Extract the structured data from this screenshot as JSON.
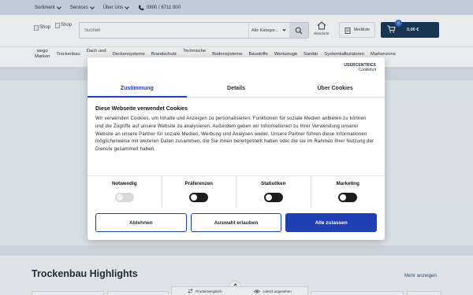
{
  "topbar": {
    "items": [
      {
        "label": "Sortiment"
      },
      {
        "label": "Services"
      },
      {
        "label": "Über Uns"
      }
    ],
    "phone": "0800 / 6711 000"
  },
  "header": {
    "logo_alt_1": "Shop",
    "logo_alt_2": "Shop",
    "search_placeholder": "Suchen",
    "category_select": "Alle Kategor...",
    "stores_label": "Standorte",
    "wishlist_label": "Merkliste",
    "cart_count": "0",
    "cart_total": "0,00 €"
  },
  "nav": {
    "items": [
      {
        "line1": "wego",
        "line2": "Marken"
      },
      {
        "line1": "Trockenbau",
        "line2": ""
      },
      {
        "line1": "Dach und",
        "line2": ""
      },
      {
        "line1": "Deckensysteme",
        "line2": ""
      },
      {
        "line1": "Brandschutz",
        "line2": ""
      },
      {
        "line1": "Technische",
        "line2": ""
      },
      {
        "line1": "Bodensysteme",
        "line2": ""
      },
      {
        "line1": "Baustoffe",
        "line2": ""
      },
      {
        "line1": "Werkzeuge",
        "line2": ""
      },
      {
        "line1": "Sanitär",
        "line2": ""
      },
      {
        "line1": "Systemkalkulatoren",
        "line2": ""
      },
      {
        "line1": "Markenzone",
        "line2": ""
      }
    ]
  },
  "cookie": {
    "brand_name": "USERCENTRICS",
    "brand_sub": "Cookiebot",
    "tabs": [
      {
        "label": "Zustimmung"
      },
      {
        "label": "Details"
      },
      {
        "label": "Über Cookies"
      }
    ],
    "heading": "Diese Webseite verwendet Cookies",
    "body": "Wir verwenden Cookies, um Inhalte und Anzeigen zu personalisieren, Funktionen für soziale Medien anbieten zu können und die Zugriffe auf unsere Website zu analysieren. Außerdem geben wir Informationen zu Ihrer Verwendung unserer Website an unsere Partner für soziale Medien, Werbung und Analysen weiter. Unsere Partner führen diese Informationen möglicherweise mit weiteren Daten zusammen, die Sie ihnen bereitgestellt haben oder die sie im Rahmen Ihrer Nutzung der Dienste gesammelt haben.",
    "categories": [
      {
        "label": "Notwendig",
        "state": "disabled-on"
      },
      {
        "label": "Präferenzen",
        "state": "off"
      },
      {
        "label": "Statistiken",
        "state": "off"
      },
      {
        "label": "Marketing",
        "state": "off"
      }
    ],
    "buttons": {
      "deny": "Ablehnen",
      "selection": "Auswahl erlauben",
      "allow_all": "Alle zulassen"
    }
  },
  "section": {
    "title": "Trockenbau Highlights",
    "more_link": "Mehr anzeigen"
  },
  "bottombar": {
    "compare": "Produktvergleich",
    "recent": "zuletzt angesehen"
  }
}
